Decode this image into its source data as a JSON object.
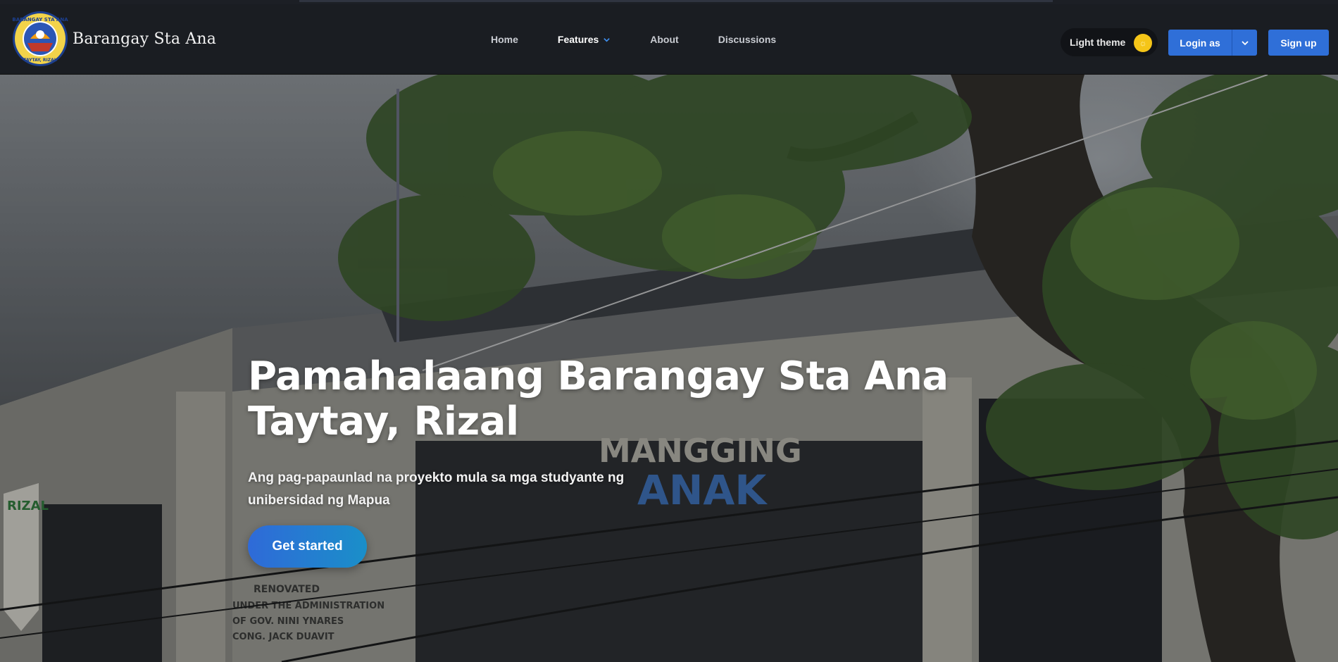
{
  "brand": {
    "name": "Barangay Sta Ana",
    "logo_icon": "barangay-seal-icon",
    "seal_text_top": "BARANGAY STA ANA",
    "seal_text_bottom": "TAYTAY, RIZAL"
  },
  "nav": {
    "items": [
      {
        "label": "Home"
      },
      {
        "label": "Features",
        "has_dropdown": true
      },
      {
        "label": "About"
      },
      {
        "label": "Discussions"
      }
    ]
  },
  "theme_toggle": {
    "label": "Light theme",
    "icon": "sun-icon",
    "color": "#f5c518"
  },
  "auth": {
    "login_label": "Login as",
    "login_dropdown_icon": "chevron-down-icon",
    "signup_label": "Sign up",
    "accent": "#2f6fd8"
  },
  "hero": {
    "title_line1": "Pamahalaang Barangay Sta Ana",
    "title_line2": "Taytay, Rizal",
    "subtitle": "Ang pag-papaunlad na proyekto mula sa mga studyante ng unibersidad ng Mapua",
    "cta_label": "Get started",
    "photo_signage": [
      "MANGGING",
      "ANAK",
      "RIZAL",
      "RENOVATED",
      "UNDER THE ADMINISTRATION",
      "OF GOV. NINI YNARES",
      "CONG. JACK DUAVIT"
    ]
  }
}
